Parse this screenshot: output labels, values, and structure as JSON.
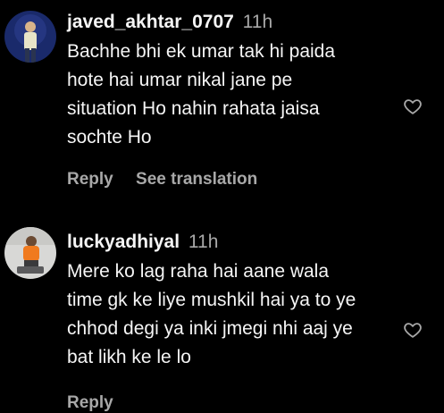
{
  "comments": [
    {
      "username": "javed_akhtar_0707",
      "time": "11h",
      "text": "Bachhe bhi ek umar tak hi paida\nhote hai umar nikal jane pe\nsituation Ho nahin rahata jaisa\nsochte Ho",
      "reply_label": "Reply",
      "translate_label": "See translation"
    },
    {
      "username": "luckyadhiyal",
      "time": "11h",
      "text": "Mere ko lag raha hai aane wala\ntime gk ke liye mushkil hai ya to ye\nchhod degi ya inki jmegi nhi aaj ye\nbat likh ke le lo",
      "reply_label": "Reply"
    }
  ],
  "icons": {
    "like": "heart-outline-icon"
  },
  "colors": {
    "background": "#000000",
    "primary_text": "#f5f5f5",
    "secondary_text": "#a8a8a8"
  }
}
